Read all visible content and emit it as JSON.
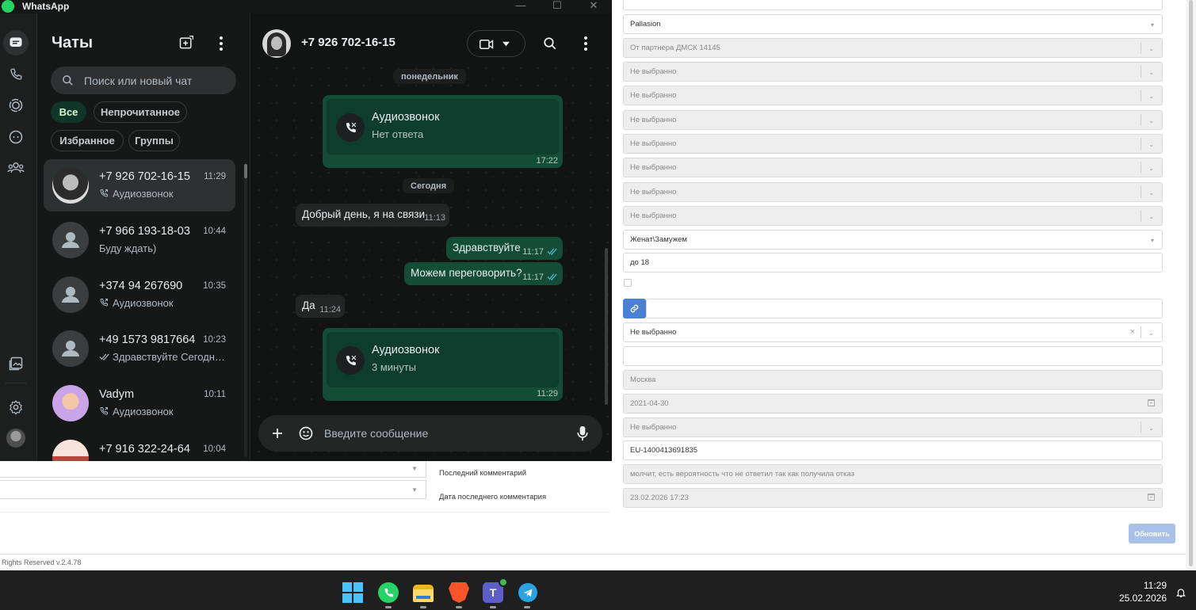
{
  "crm": {
    "fields": [
      {
        "value": "",
        "kind": "text",
        "disabled": false
      },
      {
        "value": "Pallasion",
        "kind": "select",
        "disabled": false
      },
      {
        "value": "От партнера ДМСК 14145",
        "kind": "select",
        "disabled": true
      },
      {
        "value": "Не выбранно",
        "kind": "select",
        "disabled": true
      },
      {
        "value": "Не выбранно",
        "kind": "select",
        "disabled": true
      },
      {
        "value": "Не выбранно",
        "kind": "select",
        "disabled": true
      },
      {
        "value": "Не выбранно",
        "kind": "select",
        "disabled": true
      },
      {
        "value": "Не выбранно",
        "kind": "select",
        "disabled": true
      },
      {
        "value": "Не выбранно",
        "kind": "select",
        "disabled": true
      },
      {
        "value": "Не выбранно",
        "kind": "select",
        "disabled": true
      },
      {
        "value": "Женат\\Замужем",
        "kind": "select",
        "disabled": false
      },
      {
        "value": "до 18",
        "kind": "text",
        "disabled": false
      }
    ],
    "fields_lower": [
      {
        "value": "Не выбранно",
        "kind": "select-clear",
        "disabled": false
      },
      {
        "value": "",
        "kind": "text",
        "disabled": false
      },
      {
        "value": "Москва",
        "kind": "text",
        "disabled": true
      },
      {
        "value": "2021-04-30",
        "kind": "date",
        "disabled": true
      },
      {
        "value": "Не выбранно",
        "kind": "select",
        "disabled": true
      },
      {
        "value": "EU-1400413691835",
        "kind": "text",
        "disabled": false
      },
      {
        "value": "молчит, есть вероятность что не ответил так как получила отказ",
        "kind": "text",
        "disabled": true
      },
      {
        "value": "23.02.2026 17:23",
        "kind": "date",
        "disabled": true
      }
    ],
    "labels": {
      "last_comment": "Последний комментарий",
      "last_comment_date": "Дата последнего комментария"
    },
    "update_button": "Обновить",
    "footer": "Rights Reserved v.2.4.78",
    "accent": "#4a7fd6"
  },
  "whatsapp": {
    "window_title": "WhatsApp",
    "window_controls": {
      "minimize": "—",
      "maximize": "☐",
      "close": "✕"
    },
    "chats_title": "Чаты",
    "search_placeholder": "Поиск или новый чат",
    "filters": [
      "Все",
      "Непрочитанное",
      "Избранное",
      "Группы"
    ],
    "chats": [
      {
        "name": "+7 926 702-16-15",
        "time": "11:29",
        "preview": "Аудиозвонок",
        "icon": "call-icon",
        "active": true
      },
      {
        "name": "+7 966 193-18-03",
        "time": "10:44",
        "preview": "Буду ждать)",
        "icon": "",
        "active": false
      },
      {
        "name": "+374 94 267690",
        "time": "10:35",
        "preview": "Аудиозвонок",
        "icon": "call-icon",
        "active": false
      },
      {
        "name": "+49 1573 9817664",
        "time": "10:23",
        "preview": "Здравствуйте Сегодн…",
        "icon": "double-check-icon",
        "active": false
      },
      {
        "name": "Vadym",
        "time": "10:11",
        "preview": "Аудиозвонок",
        "icon": "call-icon",
        "active": false
      },
      {
        "name": "+7 916 322-24-64",
        "time": "10:04",
        "preview": "",
        "icon": "",
        "active": false
      }
    ],
    "conversation": {
      "contact": "+7 926 702-16-15",
      "day_monday": "понедельник",
      "day_today": "Сегодня",
      "call1": {
        "title": "Аудиозвонок",
        "sub": "Нет ответа",
        "time": "17:22"
      },
      "msg_in_1": {
        "text": "Добрый день, я на связи",
        "time": "11:13"
      },
      "msg_out_1": {
        "text": "Здравствуйте",
        "time": "11:17"
      },
      "msg_out_2": {
        "text": "Можем переговорить?",
        "time": "11:17"
      },
      "msg_in_2": {
        "text": "Да",
        "time": "11:24"
      },
      "call2": {
        "title": "Аудиозвонок",
        "sub": "3 минуты",
        "time": "11:29"
      },
      "composer_placeholder": "Введите сообщение"
    },
    "colors": {
      "bubble_out": "#144d37",
      "accent": "#25d366",
      "tick": "#53bdeb"
    }
  },
  "taskbar": {
    "apps": [
      "windows-start-icon",
      "whatsapp-icon",
      "file-explorer-icon",
      "brave-browser-icon",
      "teams-icon",
      "telegram-icon"
    ],
    "time": "11:29",
    "date": "25.02.2026"
  }
}
